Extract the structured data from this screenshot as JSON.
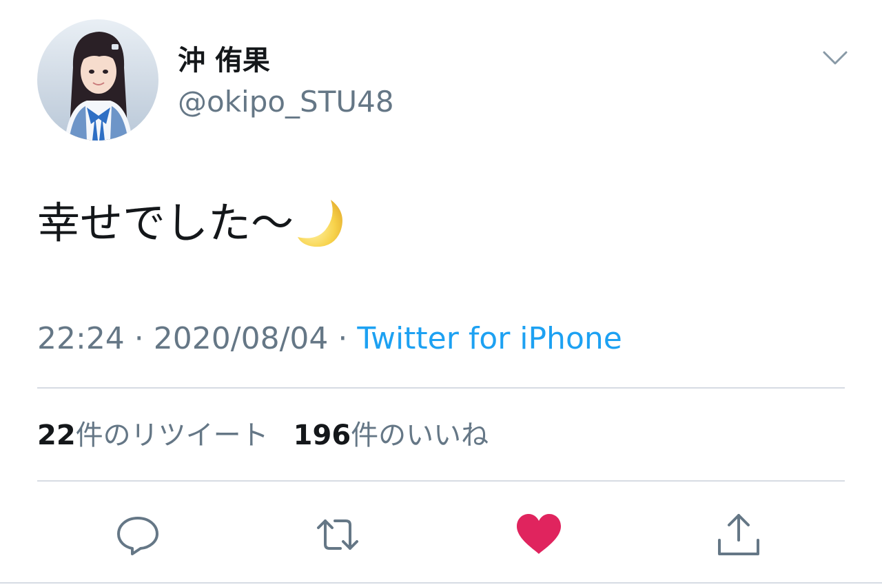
{
  "user": {
    "display_name": "沖 侑果",
    "handle": "@okipo_STU48"
  },
  "tweet": {
    "text": "幸せでした〜",
    "emoji": "crescent-moon"
  },
  "meta": {
    "time": "22:24",
    "separator": " · ",
    "date": "2020/08/04",
    "source": "Twitter for iPhone"
  },
  "stats": {
    "retweets_count": "22",
    "retweets_label": "件のリツイート",
    "likes_count": "196",
    "likes_label": "件のいいね"
  },
  "actions": {
    "reply_icon": "reply-bubble",
    "retweet_icon": "retweet-arrows",
    "like_icon": "heart-filled",
    "share_icon": "share-upload"
  },
  "colors": {
    "text_primary": "#14171a",
    "text_secondary": "#657786",
    "link": "#1da1f2",
    "like": "#e0245e",
    "divider": "#d6dbe3"
  }
}
